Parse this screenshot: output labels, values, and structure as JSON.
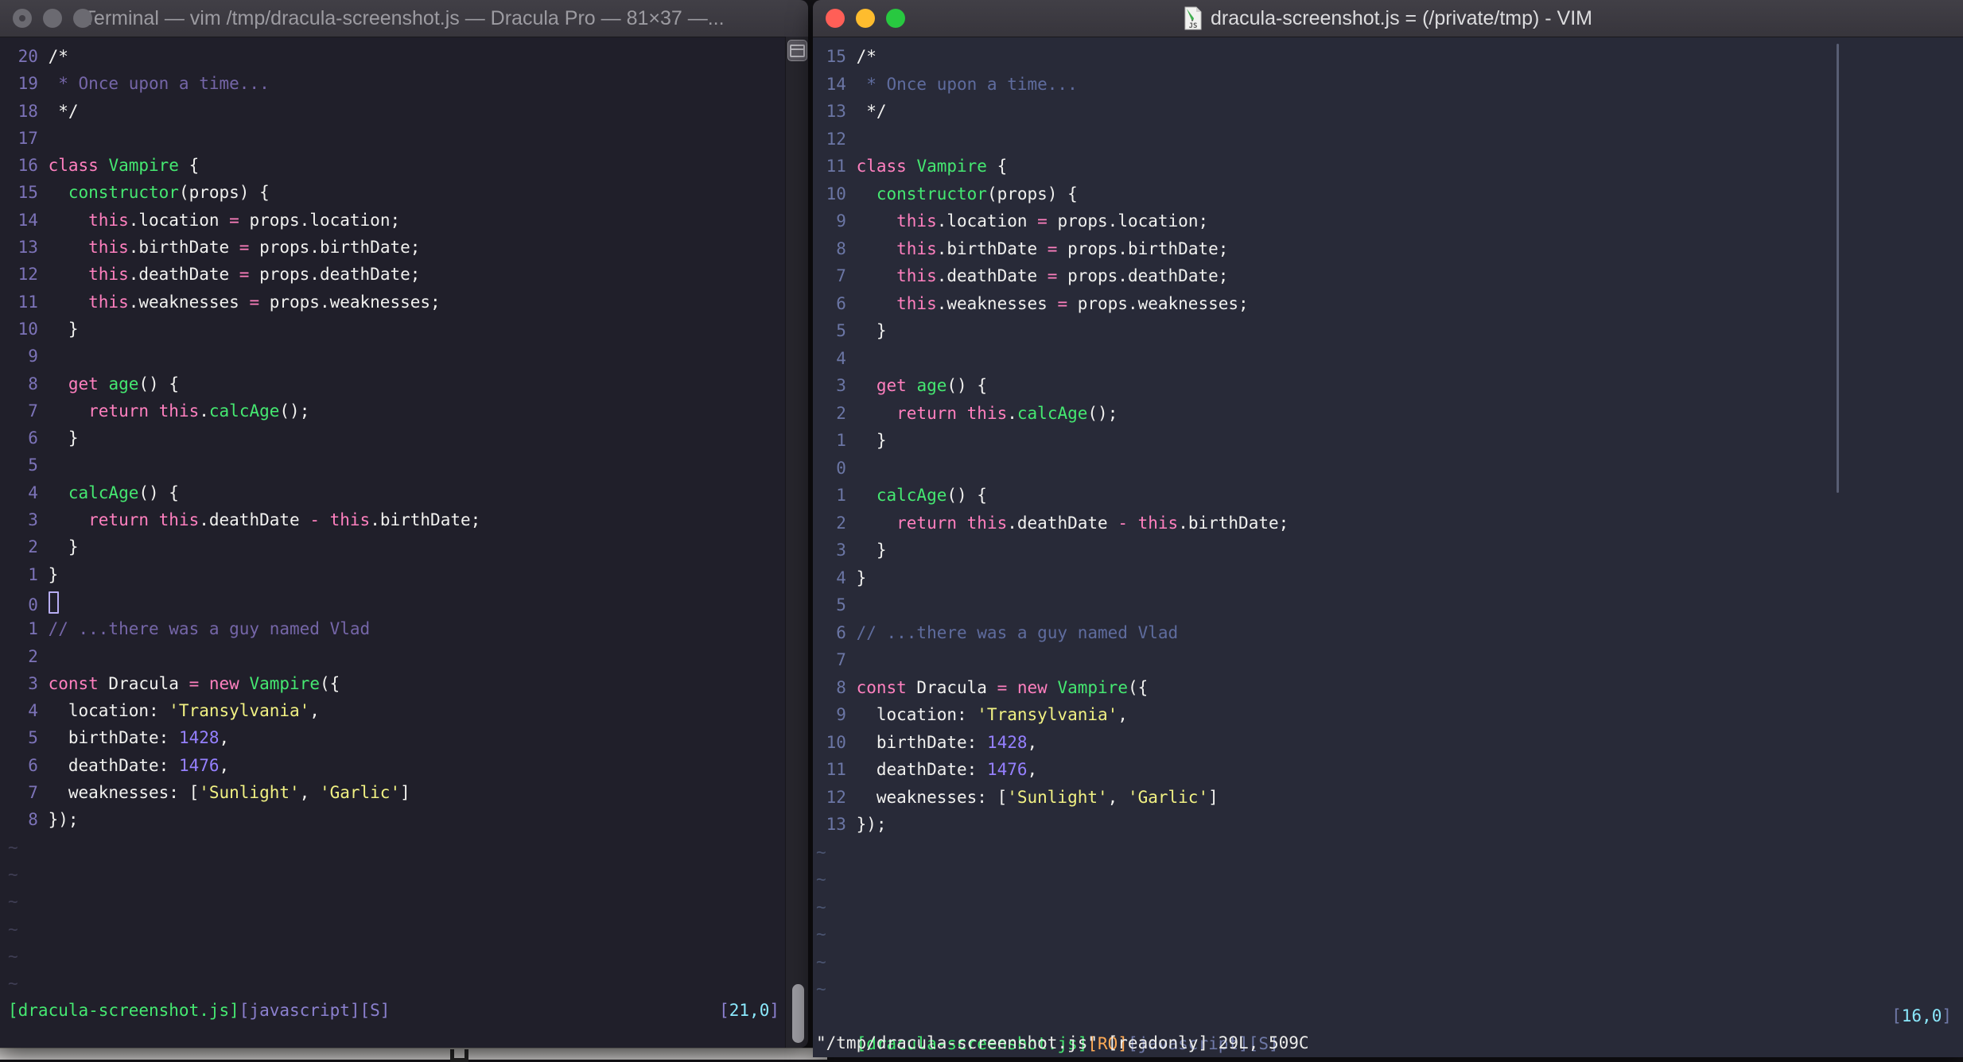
{
  "palette": {
    "terminal_background": "#201F2A",
    "vim_background": "#282A38",
    "foreground": "#F1F1EF",
    "pink": "#FF80BF",
    "green": "#45E871",
    "yellow": "#F1F183",
    "purple": "#9580FF",
    "cyan": "#8BE9FD",
    "orange": "#FFAA55",
    "comment": "#7566A8",
    "traffic_red": "#FF5F57",
    "traffic_yellow": "#FEBC2E",
    "traffic_green": "#28C840"
  },
  "windows": {
    "left": {
      "title": "Terminal — vim /tmp/dracula-screenshot.js — Dracula Pro — 81×37 —...",
      "cursor_line": 21,
      "cursor_col": 0,
      "cursor_style": "hollow",
      "tilde_count": 6,
      "status_segments": [
        [
          "g",
          "[dracula-screenshot.js]"
        ],
        [
          "p",
          "[javascript][S]"
        ]
      ],
      "ruler_segments": [
        [
          "p",
          "["
        ],
        [
          "cy",
          "21,0"
        ],
        [
          "p",
          "]"
        ]
      ],
      "command_line": ""
    },
    "right": {
      "title": "dracula-screenshot.js = (/private/tmp) - VIM",
      "cursor_line": 16,
      "cursor_col": 0,
      "cursor_style": "none",
      "tilde_count": 6,
      "status_segments": [
        [
          "g",
          "[dracula-screenshot.js]"
        ],
        [
          "or",
          "[RO]"
        ],
        [
          "b",
          "[javascript][S]"
        ]
      ],
      "ruler_segments": [
        [
          "b",
          "["
        ],
        [
          "cy",
          "16,0"
        ],
        [
          "b",
          "]"
        ]
      ],
      "message_line": "\"/tmp/dracula-screenshot.js\" [readonly] 29L, 509C"
    }
  },
  "code_lines": [
    [
      [
        "w",
        "/*"
      ]
    ],
    [
      [
        "c",
        " * Once upon a time..."
      ]
    ],
    [
      [
        "w",
        " */"
      ]
    ],
    [],
    [
      [
        "k",
        "class"
      ],
      [
        "w",
        " "
      ],
      [
        "f",
        "Vampire"
      ],
      [
        "w",
        " {"
      ]
    ],
    [
      [
        "w",
        "  "
      ],
      [
        "f",
        "constructor"
      ],
      [
        "w",
        "(props) {"
      ]
    ],
    [
      [
        "w",
        "    "
      ],
      [
        "k",
        "this"
      ],
      [
        "w",
        ".location "
      ],
      [
        "k",
        "="
      ],
      [
        "w",
        " props.location;"
      ]
    ],
    [
      [
        "w",
        "    "
      ],
      [
        "k",
        "this"
      ],
      [
        "w",
        ".birthDate "
      ],
      [
        "k",
        "="
      ],
      [
        "w",
        " props.birthDate;"
      ]
    ],
    [
      [
        "w",
        "    "
      ],
      [
        "k",
        "this"
      ],
      [
        "w",
        ".deathDate "
      ],
      [
        "k",
        "="
      ],
      [
        "w",
        " props.deathDate;"
      ]
    ],
    [
      [
        "w",
        "    "
      ],
      [
        "k",
        "this"
      ],
      [
        "w",
        ".weaknesses "
      ],
      [
        "k",
        "="
      ],
      [
        "w",
        " props.weaknesses;"
      ]
    ],
    [
      [
        "w",
        "  }"
      ]
    ],
    [],
    [
      [
        "w",
        "  "
      ],
      [
        "k",
        "get"
      ],
      [
        "w",
        " "
      ],
      [
        "f",
        "age"
      ],
      [
        "w",
        "() {"
      ]
    ],
    [
      [
        "w",
        "    "
      ],
      [
        "k",
        "return"
      ],
      [
        "w",
        " "
      ],
      [
        "k",
        "this"
      ],
      [
        "w",
        "."
      ],
      [
        "f",
        "calcAge"
      ],
      [
        "w",
        "();"
      ]
    ],
    [
      [
        "w",
        "  }"
      ]
    ],
    [],
    [
      [
        "w",
        "  "
      ],
      [
        "f",
        "calcAge"
      ],
      [
        "w",
        "() {"
      ]
    ],
    [
      [
        "w",
        "    "
      ],
      [
        "k",
        "return"
      ],
      [
        "w",
        " "
      ],
      [
        "k",
        "this"
      ],
      [
        "w",
        ".deathDate "
      ],
      [
        "k",
        "-"
      ],
      [
        "w",
        " "
      ],
      [
        "k",
        "this"
      ],
      [
        "w",
        ".birthDate;"
      ]
    ],
    [
      [
        "w",
        "  }"
      ]
    ],
    [
      [
        "w",
        "}"
      ]
    ],
    [],
    [
      [
        "c",
        "// ...there was a guy named Vlad"
      ]
    ],
    [],
    [
      [
        "k",
        "const"
      ],
      [
        "w",
        " Dracula "
      ],
      [
        "k",
        "="
      ],
      [
        "w",
        " "
      ],
      [
        "k",
        "new"
      ],
      [
        "w",
        " "
      ],
      [
        "f",
        "Vampire"
      ],
      [
        "w",
        "({"
      ]
    ],
    [
      [
        "w",
        "  location: "
      ],
      [
        "s",
        "'Transylvania'"
      ],
      [
        "w",
        ","
      ]
    ],
    [
      [
        "w",
        "  birthDate: "
      ],
      [
        "n",
        "1428"
      ],
      [
        "w",
        ","
      ]
    ],
    [
      [
        "w",
        "  deathDate: "
      ],
      [
        "n",
        "1476"
      ],
      [
        "w",
        ","
      ]
    ],
    [
      [
        "w",
        "  weaknesses: ["
      ],
      [
        "s",
        "'Sunlight'"
      ],
      [
        "w",
        ", "
      ],
      [
        "s",
        "'Garlic'"
      ],
      [
        "w",
        "]"
      ]
    ],
    [
      [
        "w",
        "});"
      ]
    ]
  ]
}
